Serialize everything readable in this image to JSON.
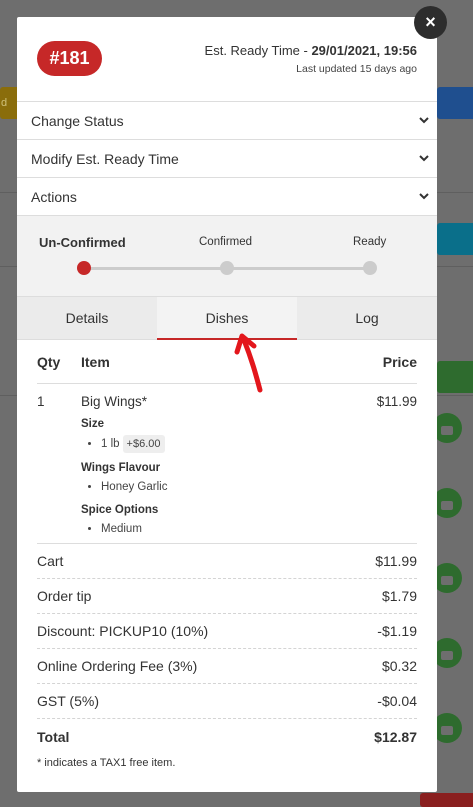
{
  "background": {
    "partial_tags": [
      {
        "text": "d",
        "color": "#8a6d0b"
      }
    ]
  },
  "modal": {
    "close_symbol": "×",
    "order_number": "#181",
    "eta_label": "Est. Ready Time - ",
    "eta_value": "29/01/2021, 19:56",
    "last_updated": "Last updated 15 days ago"
  },
  "dropdowns": [
    {
      "label": "Change Status"
    },
    {
      "label": "Modify Est. Ready Time"
    },
    {
      "label": "Actions"
    }
  ],
  "status": {
    "steps": [
      "Un-Confirmed",
      "Confirmed",
      "Ready"
    ],
    "active_index": 0,
    "progress_fraction": 0
  },
  "tabs": [
    "Details",
    "Dishes",
    "Log"
  ],
  "active_tab": "Dishes",
  "table": {
    "headers": {
      "qty": "Qty",
      "item": "Item",
      "price": "Price"
    },
    "dish": {
      "qty": "1",
      "name": "Big Wings*",
      "price": "$11.99",
      "options": [
        {
          "title": "Size",
          "values": [
            "1 lb"
          ],
          "surcharge": "+$6.00"
        },
        {
          "title": "Wings Flavour",
          "values": [
            "Honey Garlic"
          ]
        },
        {
          "title": "Spice Options",
          "values": [
            "Medium"
          ]
        }
      ]
    },
    "summary": [
      {
        "label": "Cart",
        "value": "$11.99"
      },
      {
        "label": "Order tip",
        "value": "$1.79"
      },
      {
        "label": "Discount: PICKUP10 (10%)",
        "value": "-$1.19"
      },
      {
        "label": "Online Ordering Fee (3%)",
        "value": "$0.32"
      },
      {
        "label": "GST (5%)",
        "value": "-$0.04"
      }
    ],
    "total": {
      "label": "Total",
      "value": "$12.87"
    },
    "footnote": "* indicates a TAX1 free item."
  },
  "colors": {
    "accent": "#c62828",
    "annotation_arrow": "#e3161c"
  }
}
